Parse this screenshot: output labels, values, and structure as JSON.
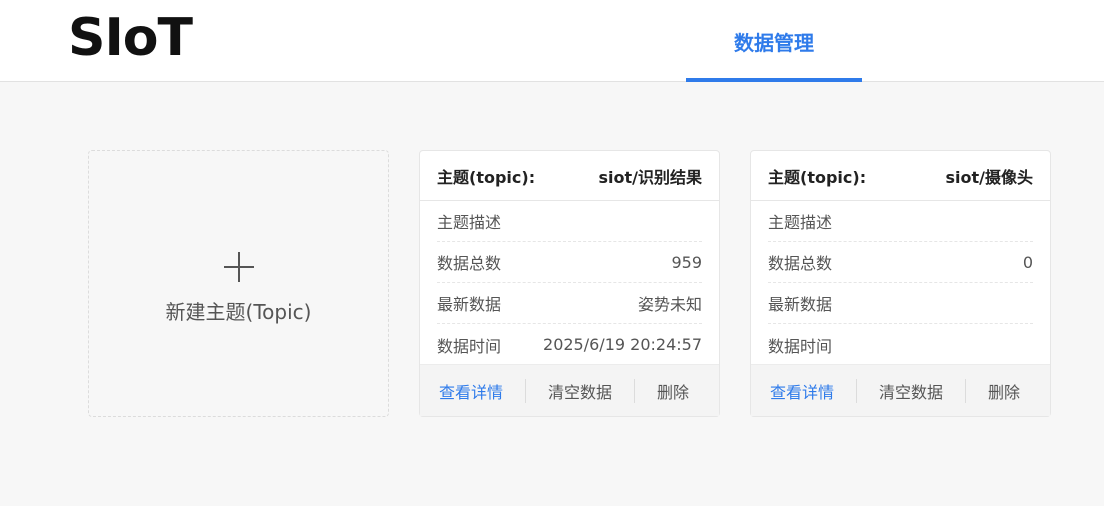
{
  "app": {
    "logo_text": "SIoT",
    "nav_tab_label": "数据管理"
  },
  "new_topic": {
    "label": "新建主题(Topic)"
  },
  "topics": [
    {
      "header_label": "主题(topic):",
      "name": "siot/识别结果",
      "rows": [
        {
          "label": "主题描述",
          "value": ""
        },
        {
          "label": "数据总数",
          "value": "959"
        },
        {
          "label": "最新数据",
          "value": "姿势未知"
        },
        {
          "label": "数据时间",
          "value": "2025/6/19 20:24:57"
        }
      ],
      "actions": {
        "view": "查看详情",
        "clear": "清空数据",
        "delete": "删除"
      }
    },
    {
      "header_label": "主题(topic):",
      "name": "siot/摄像头",
      "rows": [
        {
          "label": "主题描述",
          "value": ""
        },
        {
          "label": "数据总数",
          "value": "0"
        },
        {
          "label": "最新数据",
          "value": ""
        },
        {
          "label": "数据时间",
          "value": ""
        }
      ],
      "actions": {
        "view": "查看详情",
        "clear": "清空数据",
        "delete": "删除"
      }
    }
  ],
  "colors": {
    "accent": "#2f7bea",
    "background": "#f7f7f7"
  },
  "icons": {
    "new_topic": "plus-icon"
  }
}
